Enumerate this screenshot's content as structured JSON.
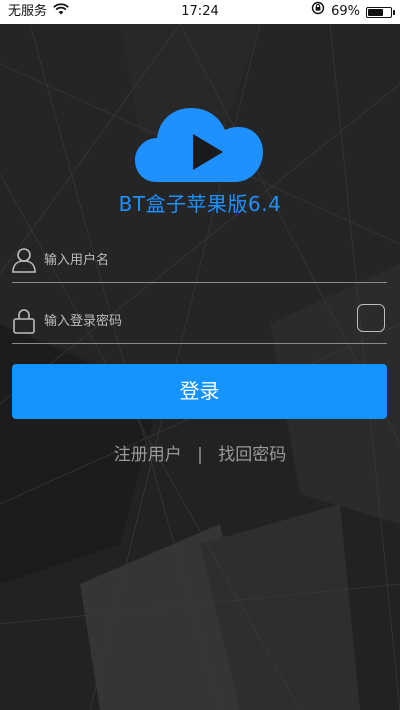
{
  "status_bar": {
    "carrier": "无服务",
    "time": "17:24",
    "battery": "69%",
    "battery_level": 0.69
  },
  "app": {
    "title": "BT盒子苹果版6.4",
    "logo_icon": "cloud-play-icon",
    "accent_color": "#1e90ff"
  },
  "form": {
    "username_placeholder": "输入用户名",
    "password_placeholder": "输入登录密码",
    "login_label": "登录"
  },
  "links": {
    "register": "注册用户",
    "separator": "|",
    "forgot_password": "找回密码"
  }
}
